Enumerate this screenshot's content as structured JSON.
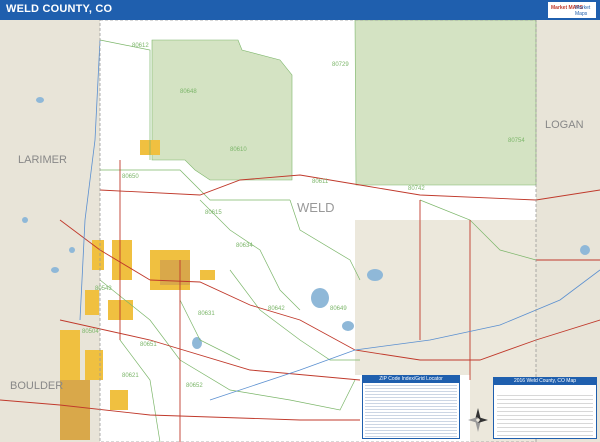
{
  "header": {
    "title": "WELD COUNTY, CO",
    "logo_primary": "Market MAPS",
    "logo_secondary": "Market Maps"
  },
  "map": {
    "county_label": "WELD",
    "neighbor_labels": {
      "larimer": "LARIMER",
      "logan": "LOGAN",
      "boulder": "BOULDER"
    },
    "zip_labels": [
      "80612",
      "80729",
      "80648",
      "80610",
      "80754",
      "80650",
      "80611",
      "80742",
      "80615",
      "80634",
      "80543",
      "80631",
      "80642",
      "80649",
      "80651",
      "80504",
      "80621",
      "80652"
    ],
    "colors": {
      "land": "#ffffff",
      "neighbor": "#e8e4d8",
      "grassland": "#d4e3c3",
      "urban": "#f0c040",
      "water": "#8fb8d8",
      "highway": "#c0392b",
      "zip_boundary": "#7cb66a",
      "title_bar": "#1f5fae"
    }
  },
  "zip_index": {
    "title": "ZIP Code Index/Grid Locator"
  },
  "legend": {
    "title": "2016 Weld County, CO Map"
  }
}
